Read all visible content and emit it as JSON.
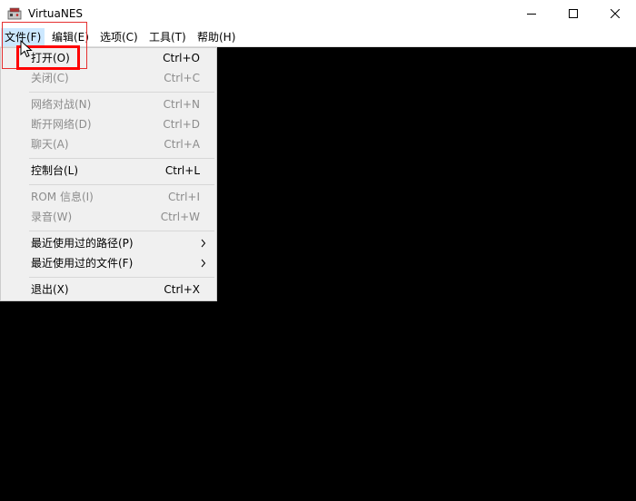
{
  "window": {
    "title": "VirtuaNES",
    "controls": [
      "minimize",
      "maximize",
      "close"
    ]
  },
  "menubar": {
    "items": [
      {
        "label": "文件(F)",
        "active": true
      },
      {
        "label": "编辑(E)"
      },
      {
        "label": "选项(C)"
      },
      {
        "label": "工具(T)"
      },
      {
        "label": "帮助(H)"
      }
    ]
  },
  "file_menu": {
    "items": [
      {
        "label": "打开(O)",
        "shortcut": "Ctrl+O",
        "enabled": true,
        "highlighted": true
      },
      {
        "label": "关闭(C)",
        "shortcut": "Ctrl+C",
        "enabled": false
      },
      {
        "label": "网络对战(N)",
        "shortcut": "Ctrl+N",
        "enabled": false
      },
      {
        "label": "断开网络(D)",
        "shortcut": "Ctrl+D",
        "enabled": false
      },
      {
        "label": "聊天(A)",
        "shortcut": "Ctrl+A",
        "enabled": false
      },
      {
        "label": "控制台(L)",
        "shortcut": "Ctrl+L",
        "enabled": true
      },
      {
        "label": "ROM 信息(I)",
        "shortcut": "Ctrl+I",
        "enabled": false
      },
      {
        "label": "录音(W)",
        "shortcut": "Ctrl+W",
        "enabled": false
      },
      {
        "label": "最近使用过的路径(P)",
        "submenu": true,
        "enabled": true
      },
      {
        "label": "最近使用过的文件(F)",
        "submenu": true,
        "enabled": true
      },
      {
        "label": "退出(X)",
        "shortcut": "Ctrl+X",
        "enabled": true
      }
    ]
  },
  "colors": {
    "annotation_red": "#ff0000",
    "menu_bg": "#f0f0f0",
    "emulator_screen": "#000000",
    "disabled_text": "#8c8c8c"
  }
}
